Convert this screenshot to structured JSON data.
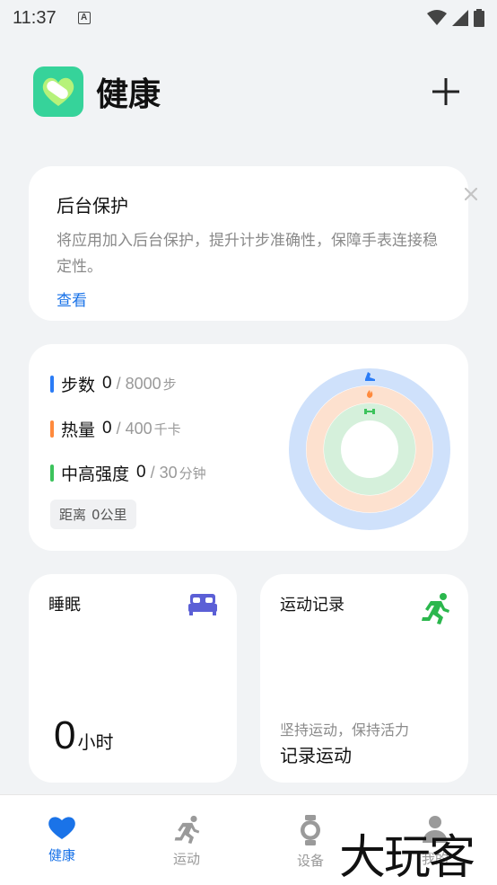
{
  "status": {
    "time": "11:37",
    "notification_icon": "a-icon"
  },
  "header": {
    "title": "健康",
    "logo_icon": "health-app-icon",
    "add_icon": "plus-icon"
  },
  "background_protection": {
    "title": "后台保护",
    "description": "将应用加入后台保护，提升计步准确性，保障手表连接稳定性。",
    "link": "查看",
    "close_icon": "close-icon"
  },
  "activity": {
    "steps": {
      "label": "步数",
      "value": "0",
      "goal": "/ 8000",
      "unit": "步",
      "color": "#2b7cf6"
    },
    "calories": {
      "label": "热量",
      "value": "0",
      "goal": "/ 400",
      "unit": "千卡",
      "color": "#ff8a3d"
    },
    "intensity": {
      "label": "中高强度",
      "value": "0",
      "goal": "/ 30",
      "unit": "分钟",
      "color": "#3cc35c"
    },
    "distance": {
      "label": "距离",
      "value": "0公里"
    },
    "rings": {
      "steps_progress": 0,
      "calories_progress": 0,
      "intensity_progress": 0
    }
  },
  "sleep": {
    "title": "睡眠",
    "value": "0",
    "unit": "小时",
    "icon": "bed-icon"
  },
  "exercise": {
    "title": "运动记录",
    "subtitle": "坚持运动，保持活力",
    "action": "记录运动",
    "icon": "running-icon"
  },
  "nav": {
    "items": [
      {
        "label": "健康",
        "icon": "heart-icon",
        "active": true
      },
      {
        "label": "运动",
        "icon": "running-icon",
        "active": false
      },
      {
        "label": "设备",
        "icon": "watch-icon",
        "active": false
      },
      {
        "label": "我的",
        "icon": "person-icon",
        "active": false
      }
    ]
  },
  "watermark": "大玩客"
}
